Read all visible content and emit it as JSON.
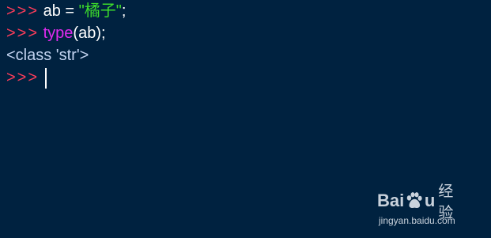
{
  "colors": {
    "background": "#002240",
    "prompt": "#ff3d5a",
    "string": "#3ddc2b",
    "builtin": "#e22bf0",
    "text": "#ffffff",
    "output": "#c2d3f0"
  },
  "console": {
    "prompt": ">>>",
    "lines": [
      {
        "prompt": ">>>",
        "code_before": " ab = ",
        "string_literal": "\"橘子\"",
        "code_after": ";"
      },
      {
        "prompt": ">>>",
        "builtin": "type",
        "code_after": "(ab);"
      },
      {
        "output": "<class 'str'>"
      },
      {
        "prompt": ">>>",
        "cursor": "text-cursor-icon"
      }
    ]
  },
  "watermark": {
    "brand_left": "Bai",
    "brand_icon": "baidu-paw-icon",
    "brand_right": "u",
    "label": "经验",
    "url": "jingyan.baidu.com"
  }
}
